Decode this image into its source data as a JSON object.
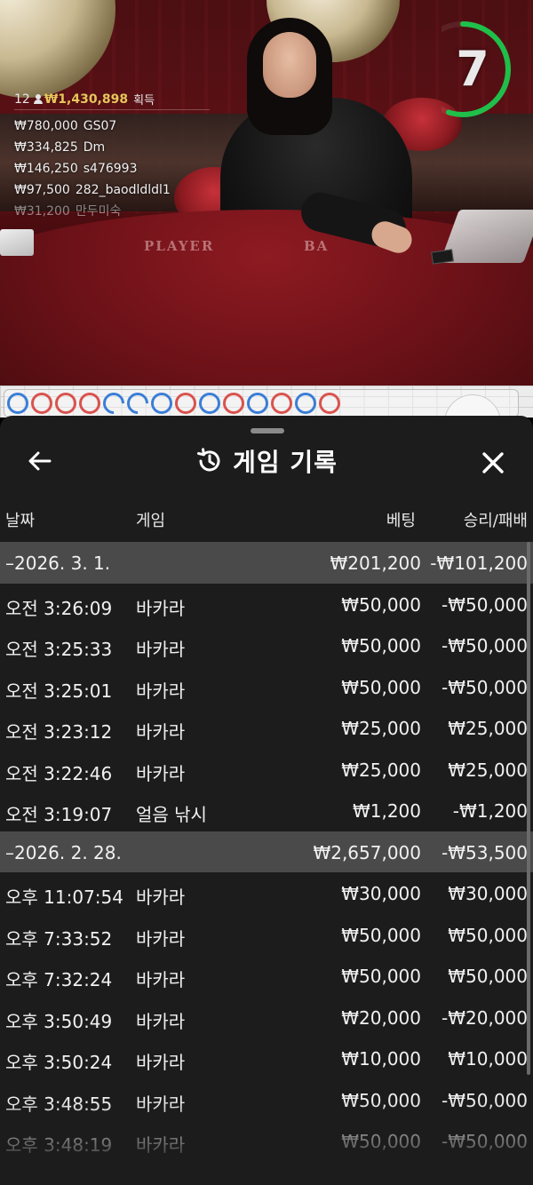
{
  "video": {
    "felt_labels": {
      "player": "PLAYER",
      "banker": "BA"
    },
    "timer": {
      "seconds": "7",
      "progress": 0.55,
      "color": "#1fbf4a"
    }
  },
  "winners": {
    "count": "12",
    "total": "₩1,430,898",
    "total_label": "획득",
    "list": [
      {
        "amount": "₩780,000",
        "name": "GS07"
      },
      {
        "amount": "₩334,825",
        "name": "Dm"
      },
      {
        "amount": "₩146,250",
        "name": "s476993"
      },
      {
        "amount": "₩97,500",
        "name": "282_baodldldl1"
      },
      {
        "amount": "₩31,200",
        "name": "만두미숙"
      }
    ]
  },
  "roadmap": {
    "beads": [
      "blue",
      "red",
      "red",
      "red",
      "half",
      "half",
      "blue",
      "red",
      "blue",
      "red",
      "blue",
      "red",
      "blue",
      "red"
    ]
  },
  "history": {
    "title": "게임 기록",
    "columns": {
      "date": "날짜",
      "game": "게임",
      "bet": "베팅",
      "result": "승리/패배"
    },
    "rows": [
      {
        "type": "group",
        "date": "–2026. 3. 1.",
        "bet": "₩201,200",
        "result": "-₩101,200"
      },
      {
        "type": "item",
        "date": "오전 3:26:09",
        "game": "바카라",
        "bet": "₩50,000",
        "result": "-₩50,000"
      },
      {
        "type": "item",
        "date": "오전 3:25:33",
        "game": "바카라",
        "bet": "₩50,000",
        "result": "-₩50,000"
      },
      {
        "type": "item",
        "date": "오전 3:25:01",
        "game": "바카라",
        "bet": "₩50,000",
        "result": "-₩50,000"
      },
      {
        "type": "item",
        "date": "오전 3:23:12",
        "game": "바카라",
        "bet": "₩25,000",
        "result": "₩25,000"
      },
      {
        "type": "item",
        "date": "오전 3:22:46",
        "game": "바카라",
        "bet": "₩25,000",
        "result": "₩25,000"
      },
      {
        "type": "item",
        "date": "오전 3:19:07",
        "game": "얼음 낚시",
        "bet": "₩1,200",
        "result": "-₩1,200"
      },
      {
        "type": "group",
        "date": "–2026. 2. 28.",
        "bet": "₩2,657,000",
        "result": "-₩53,500"
      },
      {
        "type": "item",
        "date": "오후 11:07:54",
        "game": "바카라",
        "bet": "₩30,000",
        "result": "₩30,000"
      },
      {
        "type": "item",
        "date": "오후 7:33:52",
        "game": "바카라",
        "bet": "₩50,000",
        "result": "₩50,000"
      },
      {
        "type": "item",
        "date": "오후 7:32:24",
        "game": "바카라",
        "bet": "₩50,000",
        "result": "₩50,000"
      },
      {
        "type": "item",
        "date": "오후 3:50:49",
        "game": "바카라",
        "bet": "₩20,000",
        "result": "-₩20,000"
      },
      {
        "type": "item",
        "date": "오후 3:50:24",
        "game": "바카라",
        "bet": "₩10,000",
        "result": "₩10,000"
      },
      {
        "type": "item",
        "date": "오후 3:48:55",
        "game": "바카라",
        "bet": "₩50,000",
        "result": "-₩50,000"
      },
      {
        "type": "item",
        "date": "오후 3:48:19",
        "game": "바카라",
        "bet": "₩50,000",
        "result": "-₩50,000"
      }
    ]
  }
}
